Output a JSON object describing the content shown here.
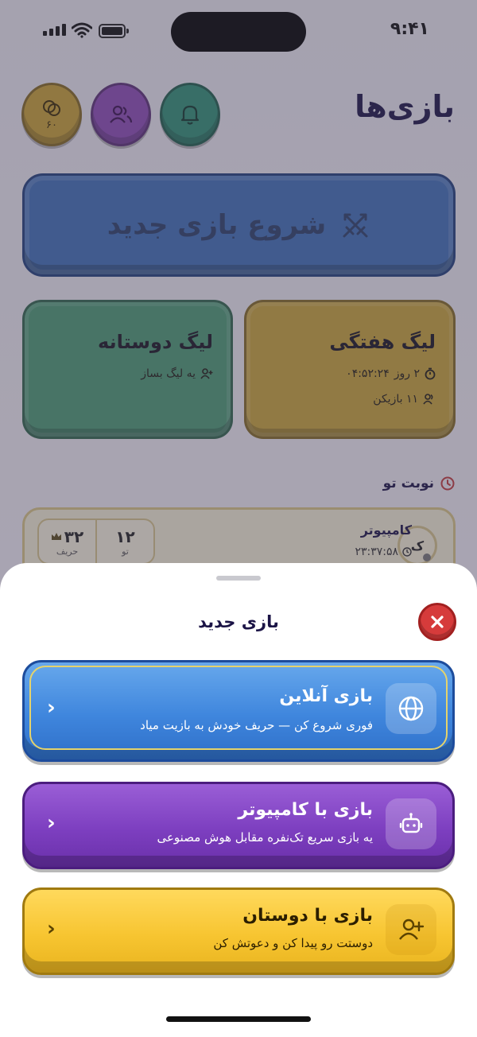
{
  "status_bar": {
    "time": "۹:۴۱"
  },
  "page": {
    "title": "بازی‌ها"
  },
  "header_buttons": {
    "coins": "۶۰"
  },
  "start_game": {
    "label": "شروع بازی جدید"
  },
  "leagues": {
    "weekly": {
      "title": "لیگ هفتگی",
      "days": "۲ روز",
      "time": "۰۴:۵۲:۲۴",
      "players": "۱۱ بازیکن"
    },
    "friends": {
      "title": "لیگ دوستانه",
      "action": "یه لیگ بساز"
    }
  },
  "your_turn": {
    "label": "نوبت تو"
  },
  "game_card": {
    "avatar_letter": "ک",
    "opponent_name": "کامپیوتر",
    "timer": "۲۳:۳۷:۵۸",
    "your_score": "۱۲",
    "your_label": "تو",
    "opponent_score": "۳۲",
    "opponent_label": "حریف"
  },
  "sheet": {
    "title": "بازی جدید",
    "options": [
      {
        "title": "بازی آنلاین",
        "subtitle": "فوری شروع کن — حریف خودش به بازیت میاد",
        "icon": "globe-icon",
        "color": "#3f86dd"
      },
      {
        "title": "بازی با کامپیوتر",
        "subtitle": "یه بازی سریع تک‌نفره مقابل هوش مصنوعی",
        "icon": "robot-icon",
        "color": "#7d3fc0"
      },
      {
        "title": "بازی با دوستان",
        "subtitle": "دوستت رو پیدا کن و دعوتش کن",
        "icon": "add-user-icon",
        "color": "#f7c531"
      }
    ]
  }
}
